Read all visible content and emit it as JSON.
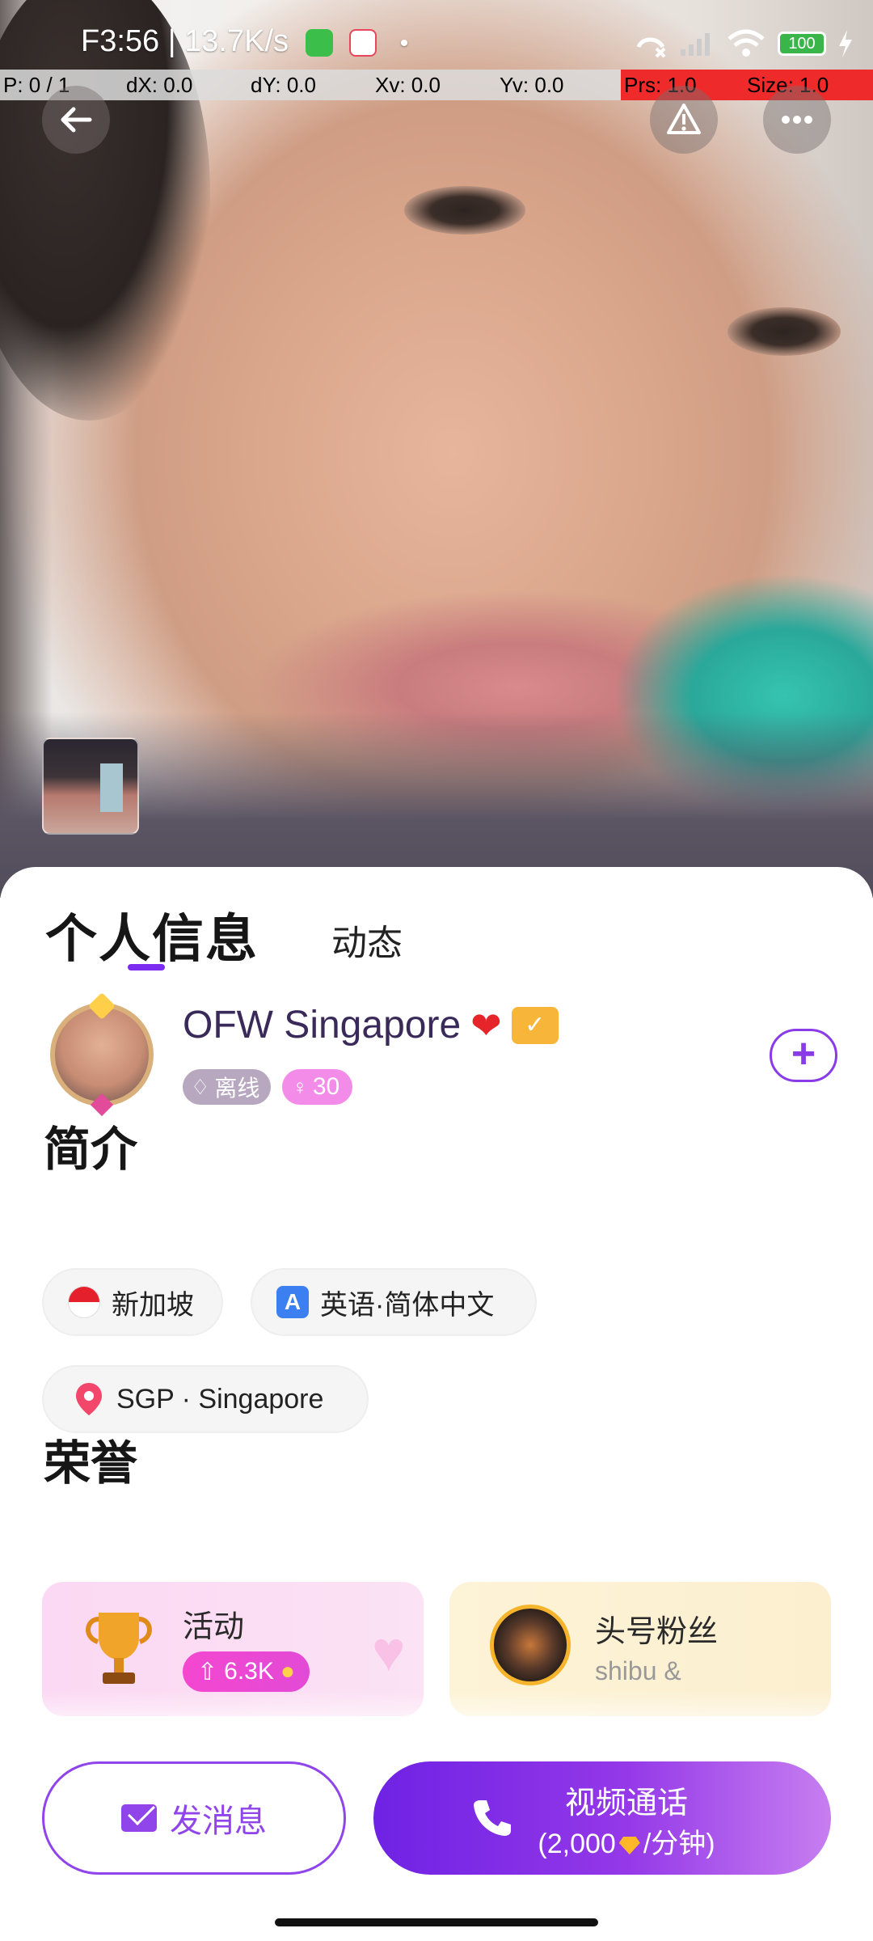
{
  "status_bar": {
    "time": "F3:56 | 13.7K/s",
    "dot": "•",
    "battery": "100"
  },
  "debug_bar": {
    "p": "P: 0 / 1",
    "dx": "dX: 0.0",
    "dy": "dY: 0.0",
    "xv": "Xv: 0.0",
    "yv": "Yv: 0.0",
    "prs": "Prs: 1.0",
    "size": "Size: 1.0"
  },
  "tabs": {
    "profile_info": "个人信息",
    "moments": "动态"
  },
  "profile": {
    "name": "OFW Singapore",
    "status": "离线",
    "level": "30"
  },
  "intro": {
    "title": "简介",
    "country": "新加坡",
    "languages": "英语·简体中文",
    "location": "SGP · Singapore"
  },
  "honors": {
    "title": "荣誉",
    "activity_label": "活动",
    "activity_coins": "6.3K",
    "top_fan_label": "头号粉丝",
    "top_fan_name": "shibu &"
  },
  "actions": {
    "message": "发消息",
    "video_call": "视频通话",
    "call_price_prefix": "(2,000",
    "call_price_suffix": "/分钟)"
  },
  "colors": {
    "accent": "#7b2cf0",
    "debug_red": "#ee2a2a"
  }
}
